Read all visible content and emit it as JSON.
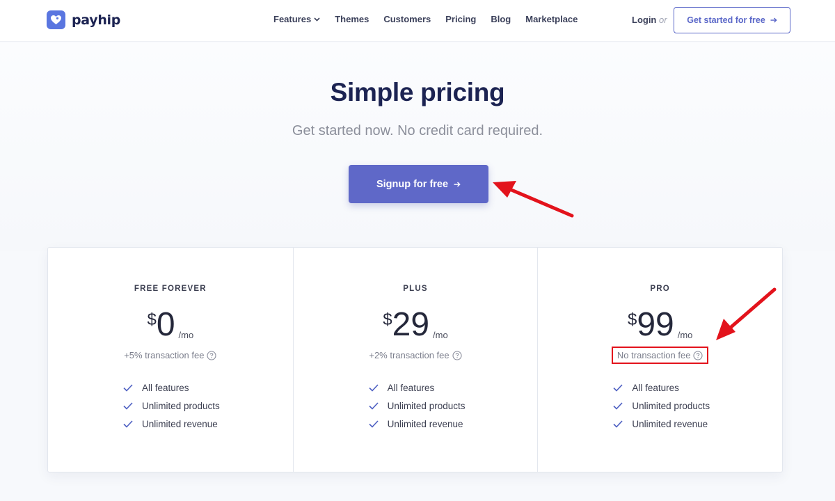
{
  "brand": {
    "name": "payhip",
    "accent": "#5f68c8",
    "logo_color": "#5a76e0"
  },
  "nav": {
    "items": [
      {
        "label": "Features",
        "has_dropdown": true
      },
      {
        "label": "Themes"
      },
      {
        "label": "Customers"
      },
      {
        "label": "Pricing"
      },
      {
        "label": "Blog"
      },
      {
        "label": "Marketplace"
      }
    ],
    "login": "Login",
    "or": "or",
    "cta": "Get started for free"
  },
  "hero": {
    "title": "Simple pricing",
    "subtitle": "Get started now. No credit card required.",
    "button": "Signup for free"
  },
  "plans": [
    {
      "name": "FREE FOREVER",
      "currency": "$",
      "amount": "0",
      "period": "/mo",
      "fee": "+5% transaction fee",
      "features": [
        "All features",
        "Unlimited products",
        "Unlimited revenue"
      ]
    },
    {
      "name": "PLUS",
      "currency": "$",
      "amount": "29",
      "period": "/mo",
      "fee": "+2% transaction fee",
      "features": [
        "All features",
        "Unlimited products",
        "Unlimited revenue"
      ]
    },
    {
      "name": "PRO",
      "currency": "$",
      "amount": "99",
      "period": "/mo",
      "fee": "No transaction fee",
      "features": [
        "All features",
        "Unlimited products",
        "Unlimited revenue"
      ]
    }
  ],
  "annotations": {
    "color": "#e3131c",
    "arrows": [
      "pointing-to-signup-button",
      "pointing-to-pro-fee"
    ]
  }
}
